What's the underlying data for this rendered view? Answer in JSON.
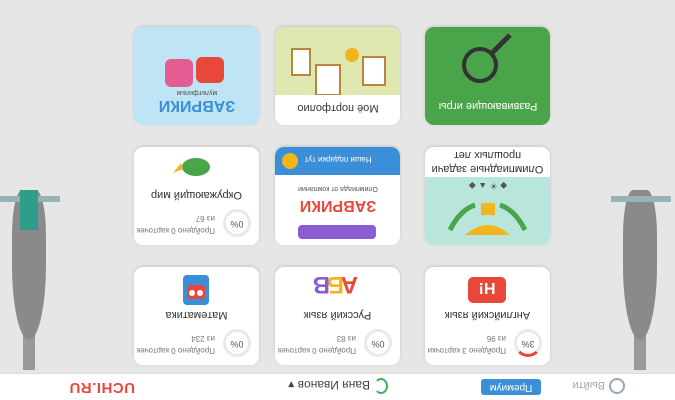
{
  "header": {
    "logo": "UCHI.RU",
    "user_name": "Ваня Иванов",
    "premium_label": "Премиум",
    "exit_label": "Выйти"
  },
  "subjects": [
    {
      "title": "Английский язык",
      "done_label": "Пройдено 3 карточки",
      "total_label": "из 96",
      "percent": "3%"
    },
    {
      "title": "Русский язык",
      "done_label": "Пройдено 0 карточек",
      "total_label": "из 83",
      "percent": "0%"
    },
    {
      "title": "Математика",
      "done_label": "Пройдено 0 карточек",
      "total_label": "из 234",
      "percent": "0%"
    },
    {
      "title": "Окружающий мир",
      "done_label": "Пройдено 0 карточек",
      "total_label": "из 67",
      "percent": "0%"
    }
  ],
  "olympiad": {
    "title": "Олимпиадные задачи",
    "subtitle": "прошлых лет"
  },
  "zavrики_mini": {
    "title": "ЗАВРИКИ",
    "caption": "Олимпиада от компании",
    "top": "Наши подарки тут"
  },
  "tiles": [
    {
      "title": "Развивающие игры"
    },
    {
      "title": "Моё портфолио"
    },
    {
      "title": "ЗАВРИКИ",
      "subtitle": "мультфильм"
    }
  ]
}
